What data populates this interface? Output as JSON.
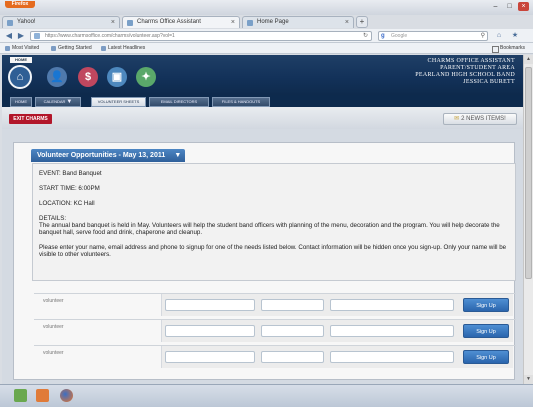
{
  "browser": {
    "menu_button": "Firefox",
    "tabs": [
      {
        "title": "Yahoo!",
        "active": false
      },
      {
        "title": "Charms Office Assistant",
        "active": true
      },
      {
        "title": "Home Page",
        "active": false
      }
    ],
    "new_tab": "+",
    "url": "https://www.charmsoffice.com/charms/volunteer.asp?vol=1",
    "search_placeholder": "Google",
    "bookmarks": [
      "Most Visited",
      "Getting Started",
      "Latest Headlines"
    ],
    "bookmarks_right": "Bookmarks"
  },
  "app": {
    "home_tag": "HOME",
    "header_lines": [
      "CHARMS OFFICE ASSISTANT",
      "PARENT/STUDENT AREA",
      "PEARLAND HIGH SCHOOL BAND",
      "JESSICA BURETT"
    ],
    "menu": [
      {
        "label": "HOME"
      },
      {
        "label": "CALENDAR",
        "arrow": "▼"
      },
      {
        "label": "VOLUNTEER SHEETS"
      },
      {
        "label": "EMAIL DIRECTORS"
      },
      {
        "label": "FILES & HANDOUTS"
      }
    ],
    "exit_label": "EXIT CHARMS",
    "news_label": "2 NEWS ITEMS!"
  },
  "panel": {
    "title": "Volunteer Opportunities - May 13, 2011",
    "title_arrow": "▼",
    "event": "EVENT: Band Banquet",
    "start_time": "START TIME: 6:00PM",
    "location": "LOCATION: KC Hall",
    "details_label": "DETAILS:",
    "details_text": "The annual band banquet is held in May.  Volunteers will help the student band officers with planning of the menu, decoration and the program.  You will help decorate the banquet hall, serve food and drink, chaperone and cleanup.",
    "instructions": "Please enter your name, email address and phone to signup for one of the needs listed below. Contact information will be hidden once you sign-up. Only your name will be visible to other volunteers."
  },
  "volunteers": [
    {
      "label": "volunteer",
      "button": "Sign Up"
    },
    {
      "label": "volunteer",
      "button": "Sign Up"
    },
    {
      "label": "volunteer",
      "button": "Sign Up"
    }
  ]
}
